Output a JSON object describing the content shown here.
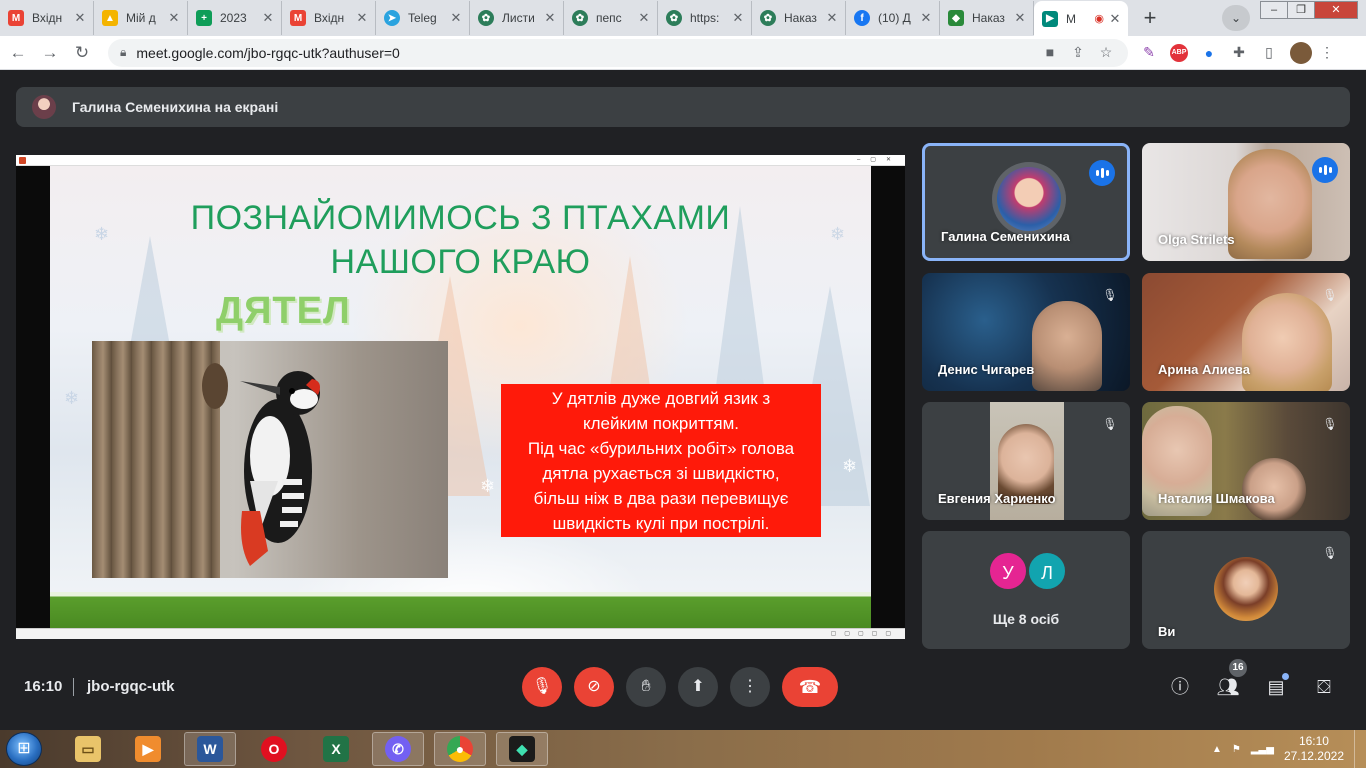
{
  "browser": {
    "tabs": [
      {
        "title": "Вхідн",
        "favicon": "gmail-icon",
        "color": "#ea4335",
        "glyph": "M"
      },
      {
        "title": "Мій д",
        "favicon": "google-drive-icon",
        "color": "#f4b400",
        "glyph": "▲"
      },
      {
        "title": "2023",
        "favicon": "google-sheets-icon",
        "color": "#0f9d58",
        "glyph": "+"
      },
      {
        "title": "Вхідн",
        "favicon": "gmail-icon",
        "color": "#ea4335",
        "glyph": "M"
      },
      {
        "title": "Teleg",
        "favicon": "telegram-icon",
        "color": "#2aa3df",
        "glyph": "➤"
      },
      {
        "title": "Листи",
        "favicon": "site-icon",
        "color": "#2d7d5a",
        "glyph": "✿"
      },
      {
        "title": "пепс",
        "favicon": "site-icon",
        "color": "#2d7d5a",
        "glyph": "✿"
      },
      {
        "title": "https:",
        "favicon": "site-icon",
        "color": "#2d7d5a",
        "glyph": "✿"
      },
      {
        "title": "Наказ",
        "favicon": "site-icon",
        "color": "#2d7d5a",
        "glyph": "✿"
      },
      {
        "title": "(10) Д",
        "favicon": "facebook-icon",
        "color": "#1877f2",
        "glyph": "f"
      },
      {
        "title": "Наказ",
        "favicon": "shield-site-icon",
        "color": "#2a8a3a",
        "glyph": "◆"
      },
      {
        "title": "M",
        "favicon": "google-meet-icon",
        "color": "#00897b",
        "glyph": "▶",
        "active": true
      }
    ],
    "new_tab": "+",
    "url": "meet.google.com/jbo-rgqc-utk?authuser=0",
    "abp_label": "ABP"
  },
  "meet": {
    "presenter_banner": "Галина Семенихина на екрані",
    "slide": {
      "title_line1": "ПОЗНАЙОМИМОСЬ З ПТАХАМИ",
      "title_line2": "НАШОГО КРАЮ",
      "bird_name": "ДЯТЕЛ",
      "fact_lines": [
        "У дятлів дуже довгий язик з",
        "клейким покриттям.",
        "Під час «бурильних робіт» голова",
        "дятла рухається зі швидкістю,",
        "більш ніж в два рази перевищує",
        "швидкість кулі при пострілі."
      ]
    },
    "participants": [
      {
        "name": "Галина Семенихина",
        "state": "speaking"
      },
      {
        "name": "Olga Strilets",
        "state": "speaking"
      },
      {
        "name": "Денис Чигарев",
        "state": "muted"
      },
      {
        "name": "Арина Алиева",
        "state": "muted"
      },
      {
        "name": "Евгения Хариенко",
        "state": "muted"
      },
      {
        "name": "Наталия Шмакова",
        "state": "muted"
      },
      {
        "name": "Ви",
        "state": "muted"
      }
    ],
    "more": {
      "initials": [
        "У",
        "Л"
      ],
      "initial_colors": [
        "#e52592",
        "#12a4af"
      ],
      "label": "Ще 8 осіб"
    },
    "bottom": {
      "time": "16:10",
      "meeting_code": "jbo-rgqc-utk",
      "people_count": "16"
    },
    "colors": {
      "accent": "#8ab4f8",
      "danger": "#ea4335",
      "surface": "#3c4043",
      "background": "#202124"
    }
  },
  "taskbar": {
    "time": "16:10",
    "date": "27.12.2022",
    "apps": [
      "file-explorer-icon",
      "media-player-icon",
      "word-icon",
      "opera-icon",
      "excel-icon",
      "viber-icon",
      "chrome-icon",
      "filmora-icon"
    ]
  }
}
